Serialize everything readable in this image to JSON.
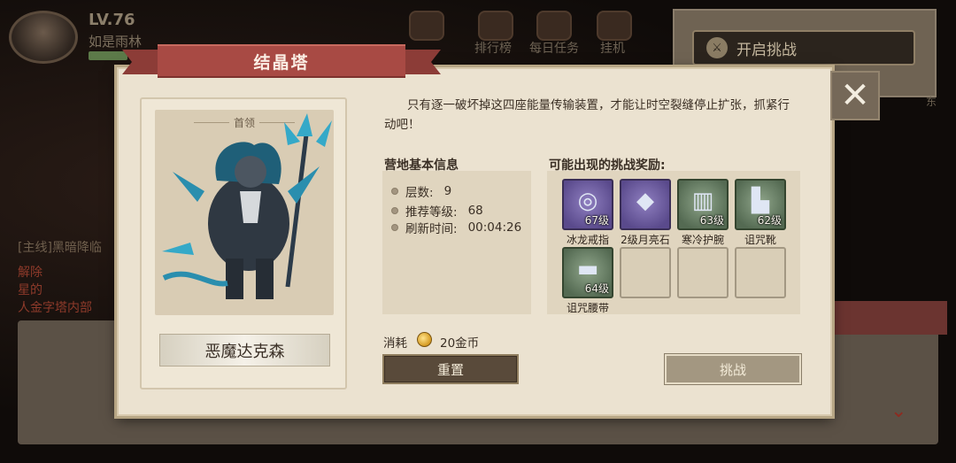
{
  "hud": {
    "level": "LV.76",
    "player_name": "如是雨林",
    "top_menu": [
      {
        "label": "排行榜"
      },
      {
        "label": "每日任务"
      },
      {
        "label": "挂机"
      }
    ],
    "challenge_button": "开启挑战",
    "quest_tag": "[主线]黑暗降临",
    "quest_text_1": "解除",
    "quest_text_2": "星的",
    "quest_text_3": "人金字塔内部",
    "east": "东"
  },
  "dialog": {
    "title": "结晶塔",
    "description": "只有逐一破坏掉这四座能量传输装置，才能让时空裂缝停止扩张，抓紧行动吧！",
    "boss": {
      "tag": "首领",
      "name": "恶魔达克森"
    },
    "camp_info": {
      "title": "营地基本信息",
      "rows": [
        {
          "label": "层数:",
          "value": "9"
        },
        {
          "label": "推荐等级:",
          "value": "68"
        },
        {
          "label": "刷新时间:",
          "value": "00:04:26"
        }
      ]
    },
    "rewards": {
      "title": "可能出现的挑战奖励:",
      "items": [
        {
          "name": "冰龙戒指",
          "level": "67级",
          "rarity": "purple",
          "icon": "ring-icon"
        },
        {
          "name": "2级月亮石",
          "level": "",
          "rarity": "purple",
          "icon": "moonstone-icon"
        },
        {
          "name": "寒冷护腕",
          "level": "63级",
          "rarity": "green",
          "icon": "bracer-icon"
        },
        {
          "name": "诅咒靴",
          "level": "62级",
          "rarity": "green",
          "icon": "boots-icon"
        },
        {
          "name": "诅咒腰带",
          "level": "64级",
          "rarity": "green",
          "icon": "belt-icon"
        }
      ]
    },
    "cost": {
      "label": "消耗",
      "value": "20金币"
    },
    "buttons": {
      "reset": "重置",
      "challenge": "挑战"
    }
  }
}
